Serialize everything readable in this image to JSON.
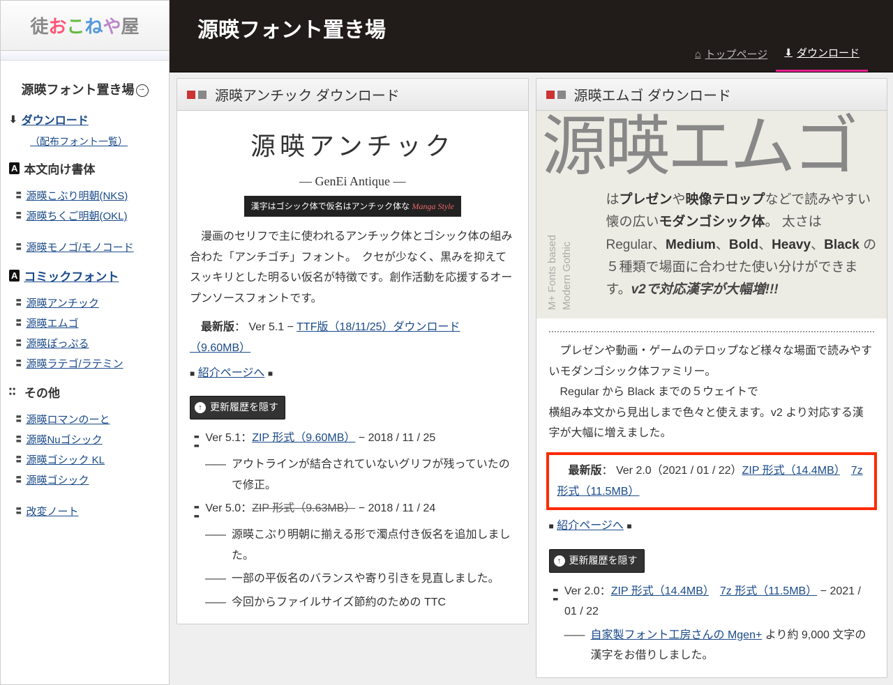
{
  "site": {
    "logo_chars": [
      "お",
      "こ",
      "ね",
      "や"
    ],
    "title": "源暎フォント置き場"
  },
  "nav": {
    "top": "トップページ",
    "download": "ダウンロード"
  },
  "sidebar": {
    "download": "ダウンロード",
    "font_list": "（配布フォント一覧）",
    "sec_body": "本文向け書体",
    "items_body": [
      "源暎こぶり明朝(NKS)",
      "源暎ちくご明朝(OKL)",
      "源暎モノゴ/モノコード"
    ],
    "sec_comic": "コミックフォント",
    "items_comic": [
      "源暎アンチック",
      "源暎エムゴ",
      "源暎ぽっぷる",
      "源暎ラテゴ/ラテミン"
    ],
    "sec_other": "その他",
    "items_other": [
      "源暎ロマンのーと",
      "源暎Nuゴシック",
      "源暎ゴシック KL",
      "源暎ゴシック",
      "改変ノート"
    ]
  },
  "antique": {
    "card_title": "源暎アンチック ダウンロード",
    "banner_t1": "源暎アンチック",
    "banner_t2": "— GenEi Antique —",
    "banner_t3a": "漢字はゴシック体で仮名はアンチック体な ",
    "banner_t3b": "Manga Style",
    "desc": "　漫画のセリフで主に使われるアンチック体とゴシック体の組み合わた「アンチゴチ」フォント。　クセが少なく、黒みを抑えてスッキリとした明るい仮名が特徴です。創作活動を応援するオープンソースフォントです。",
    "latest_label": "最新版",
    "latest_ver": "： Ver 5.1 − ",
    "latest_link": "TTF版（18/11/25）ダウンロード（9.60MB）",
    "intro": "紹介ページへ",
    "toggle": "更新履歴を隠す",
    "h1_ver": "Ver 5.1：",
    "h1_link": "ZIP 形式（9.60MB）",
    "h1_date": " − 2018 / 11 / 25",
    "h1_note": "アウトラインが結合されていないグリフが残っていたので修正。",
    "h2_ver": "Ver 5.0：",
    "h2_strike": "ZIP 形式（9.63MB）",
    "h2_date": " − 2018 / 11 / 24",
    "h2_n1": "源暎こぶり明朝に揃える形で濁点付き仮名を追加しました。",
    "h2_n2": "一部の平仮名のバランスや寄り引きを見直しました。",
    "h2_n3": "今回からファイルサイズ節約のための TTC"
  },
  "emgo": {
    "card_title": "源暎エムゴ ダウンロード",
    "big": "源暎エムゴ",
    "side1": "M+ Fonts based",
    "side2": "Modern Gothic",
    "d1a": "は",
    "d1b": "プレゼン",
    "d1c": "や",
    "d1d": "映像テロップ",
    "d1e": "などで読みやすい懐の広い",
    "d1f": "モダンゴシック体",
    "d1g": "。 太さは Regular、",
    "d1h": "Medium",
    "d1i": "、",
    "d1j": "Bold",
    "d1k": "、",
    "d1l": "Heavy",
    "d1m": "、",
    "d1n": "Black",
    "d1o": " の５種類で場面に合わせた使い分けができます。",
    "d1p": "v2で対応漢字が大幅増!!!",
    "desc2": "　プレゼンや動画・ゲームのテロップなど様々な場面で読みやすいモダンゴシック体ファミリー。\n　Regular から Black までの５ウェイトで\n横組み本文から見出しまで色々と使えます。v2 より対応する漢字が大幅に増えました。",
    "latest_label": "最新版",
    "latest_a": "： Ver 2.0（2021 / 01 / 22）",
    "latest_zip": "ZIP 形式（14.4MB）",
    "latest_7z": "7z 形式（11.5MB）",
    "intro": "紹介ページへ",
    "toggle": "更新履歴を隠す",
    "h1_ver": "Ver 2.0：",
    "h1_zip": "ZIP 形式（14.4MB）",
    "h1_7z": "7z 形式（11.5MB）",
    "h1_date": " − 2021 / 01 / 22",
    "h1_n1a": "自家製フォント工房さんの Mgen+",
    "h1_n1b": " より約 9,000 文字の漢字をお借りしました。"
  }
}
